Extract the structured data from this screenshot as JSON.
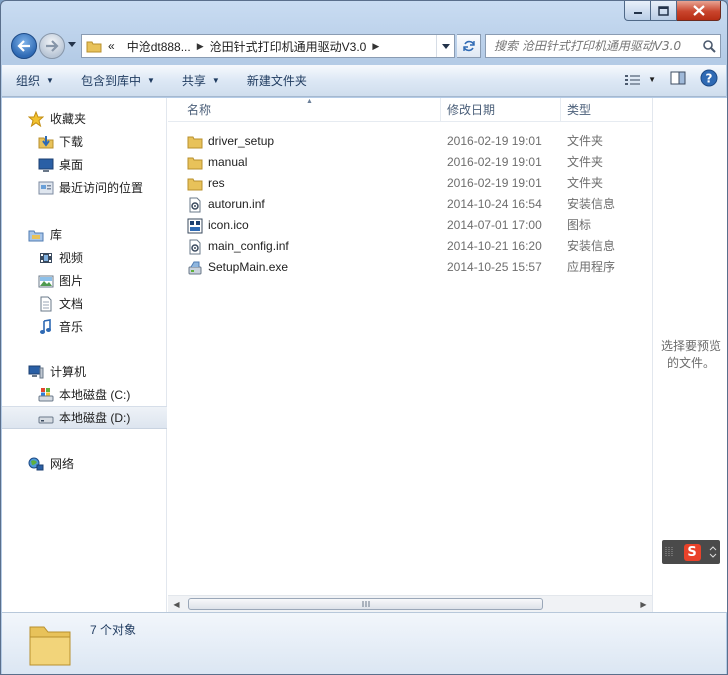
{
  "window": {
    "caption": {
      "minimize": "minimize",
      "maximize": "maximize",
      "close": "close"
    }
  },
  "address": {
    "prefix": "«",
    "segments": [
      "中沧dt888...",
      "沧田针式打印机通用驱动V3.0"
    ]
  },
  "search": {
    "placeholder": "搜索 沧田针式打印机通用驱动V3.0"
  },
  "toolbar": {
    "organize": "组织",
    "include_library": "包含到库中",
    "share": "共享",
    "new_folder": "新建文件夹"
  },
  "sidebar": {
    "favorites": {
      "label": "收藏夹",
      "items": [
        {
          "label": "下载",
          "icon": "download-folder-icon"
        },
        {
          "label": "桌面",
          "icon": "desktop-icon"
        },
        {
          "label": "最近访问的位置",
          "icon": "recent-places-icon"
        }
      ]
    },
    "libraries": {
      "label": "库",
      "items": [
        {
          "label": "视频",
          "icon": "video-library-icon"
        },
        {
          "label": "图片",
          "icon": "pictures-library-icon"
        },
        {
          "label": "文档",
          "icon": "documents-library-icon"
        },
        {
          "label": "音乐",
          "icon": "music-library-icon"
        }
      ]
    },
    "computer": {
      "label": "计算机",
      "items": [
        {
          "label": "本地磁盘 (C:)",
          "icon": "drive-c-icon"
        },
        {
          "label": "本地磁盘 (D:)",
          "icon": "drive-d-icon",
          "selected": true
        }
      ]
    },
    "network": {
      "label": "网络"
    }
  },
  "columns": {
    "name": "名称",
    "date": "修改日期",
    "type": "类型"
  },
  "files": [
    {
      "name": "driver_setup",
      "date": "2016-02-19 19:01",
      "type": "文件夹",
      "icon": "folder-icon"
    },
    {
      "name": "manual",
      "date": "2016-02-19 19:01",
      "type": "文件夹",
      "icon": "folder-icon"
    },
    {
      "name": "res",
      "date": "2016-02-19 19:01",
      "type": "文件夹",
      "icon": "folder-icon"
    },
    {
      "name": "autorun.inf",
      "date": "2014-10-24 16:54",
      "type": "安装信息",
      "icon": "inf-file-icon"
    },
    {
      "name": "icon.ico",
      "date": "2014-07-01 17:00",
      "type": "图标",
      "icon": "ico-file-icon"
    },
    {
      "name": "main_config.inf",
      "date": "2014-10-21 16:20",
      "type": "安装信息",
      "icon": "inf-file-icon"
    },
    {
      "name": "SetupMain.exe",
      "date": "2014-10-25 15:57",
      "type": "应用程序",
      "icon": "setup-exe-icon"
    }
  ],
  "preview": {
    "message_line1": "选择要预览",
    "message_line2": "的文件。"
  },
  "ime": {
    "logo": "S"
  },
  "details": {
    "count": "7 个对象"
  },
  "colors": {
    "accent": "#2f6ab4",
    "folder": "#e8c25a",
    "close": "#c9452d"
  }
}
